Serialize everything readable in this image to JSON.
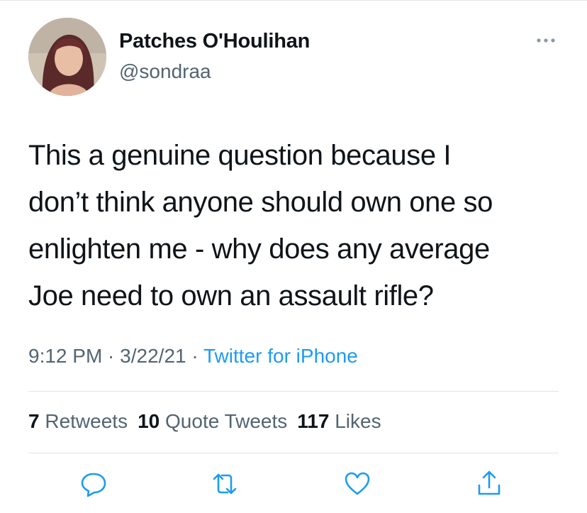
{
  "author": {
    "name": "Patches O'Houlihan",
    "handle": "@sondraa"
  },
  "tweet": {
    "lines": [
      "This a genuine question because I",
      "don’t think anyone should own one so",
      "enlighten me - why does any average",
      "Joe need to own an assault rifle?"
    ]
  },
  "meta": {
    "time": "9:12 PM",
    "sep1": " · ",
    "date": "3/22/21",
    "sep2": " · ",
    "source": "Twitter for iPhone"
  },
  "stats": {
    "retweets_count": "7",
    "retweets_label": "Retweets",
    "quotes_count": "10",
    "quotes_label": "Quote Tweets",
    "likes_count": "117",
    "likes_label": "Likes"
  },
  "icons": {
    "more": "more-horizontal-icon",
    "reply": "reply-bubble-icon",
    "retweet": "retweet-icon",
    "like": "heart-icon",
    "share": "share-icon"
  },
  "colors": {
    "link": "#1d9bf0",
    "muted": "#536471",
    "icon": "#1d9bf0"
  }
}
